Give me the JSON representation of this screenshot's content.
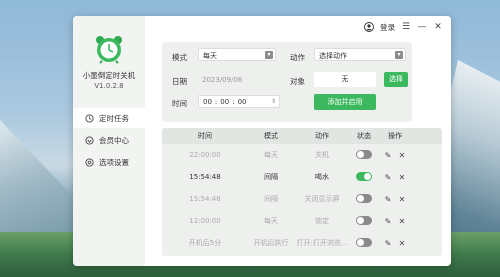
{
  "app": {
    "name": "小墨倒定时关机",
    "version": "V1.0.2.8"
  },
  "titlebar": {
    "login_label": "登录"
  },
  "sidebar": {
    "items": [
      {
        "label": "定时任务",
        "icon": "clock-icon"
      },
      {
        "label": "会员中心",
        "icon": "vip-icon"
      },
      {
        "label": "选项设置",
        "icon": "gear-icon"
      }
    ]
  },
  "form": {
    "mode_label": "模式",
    "mode_value": "每天",
    "action_label": "动作",
    "action_value": "选择动作",
    "date_label": "日期",
    "date_value": "2023/09/06",
    "object_label": "对象",
    "object_value": "无",
    "select_button": "选择",
    "time_label": "时间",
    "time_h": "00",
    "time_m": "00",
    "time_s": "00",
    "add_button": "添加并启用"
  },
  "table": {
    "headers": [
      "时间",
      "模式",
      "动作",
      "状态",
      "操作"
    ],
    "rows": [
      {
        "time": "22:00:00",
        "mode": "每天",
        "action": "关机",
        "enabled": false
      },
      {
        "time": "15:54:48",
        "mode": "间隔",
        "action": "喝水",
        "enabled": true
      },
      {
        "time": "15:54:48",
        "mode": "间隔",
        "action": "关闭显示屏",
        "enabled": false
      },
      {
        "time": "12:00:00",
        "mode": "每天",
        "action": "锁定",
        "enabled": false
      },
      {
        "time": "开机后5分",
        "mode": "开机后执行",
        "action": "打开:打开浏览...",
        "enabled": false
      }
    ]
  },
  "colors": {
    "accent": "#3cb95f",
    "sidebar_bg": "#f2f4f2"
  }
}
